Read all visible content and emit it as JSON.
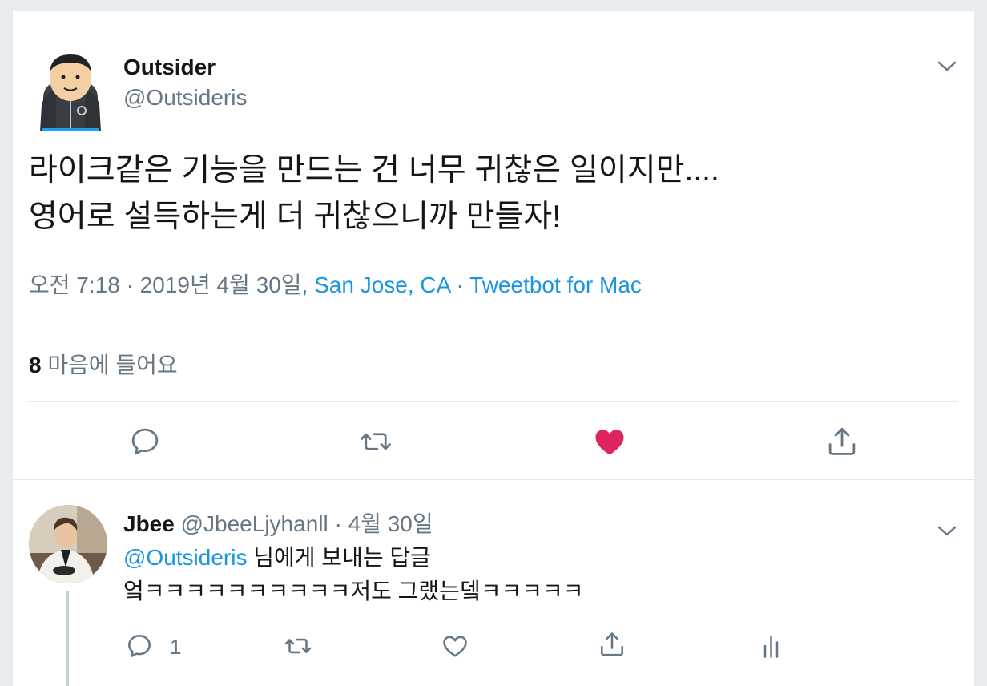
{
  "main_tweet": {
    "display_name": "Outsider",
    "handle": "@Outsideris",
    "text_line1": "라이크같은 기능을 만드는 건 너무 귀찮은 일이지만....",
    "text_line2": "영어로 설득하는게 더 귀찮으니까 만들자!",
    "timestamp": "오전 7:18 · 2019년 4월 30일, ",
    "location": "San Jose, CA",
    "separator": " · ",
    "source": "Tweetbot for Mac",
    "likes_count": "8",
    "likes_label": " 마음에 들어요",
    "liked": true,
    "icons": [
      "reply-icon",
      "retweet-icon",
      "heart-filled-icon",
      "share-icon",
      "chevron-down-icon"
    ],
    "colors": {
      "heart": "#e0245e",
      "link": "#1b95e0",
      "muted": "#657786"
    }
  },
  "reply_tweet": {
    "display_name": "Jbee",
    "handle": "@JbeeLjyhanll",
    "date": " · 4월 30일",
    "reply_to_handle": "@Outsideris",
    "reply_to_suffix": " 님에게 보내는 답글",
    "text": "엌ㅋㅋㅋㅋㅋㅋㅋㅋㅋㅋ저도 그랬는뎈ㅋㅋㅋㅋㅋ",
    "reply_count": "1",
    "icons": [
      "reply-icon",
      "retweet-icon",
      "heart-outline-icon",
      "share-icon",
      "analytics-icon",
      "chevron-down-icon"
    ]
  }
}
